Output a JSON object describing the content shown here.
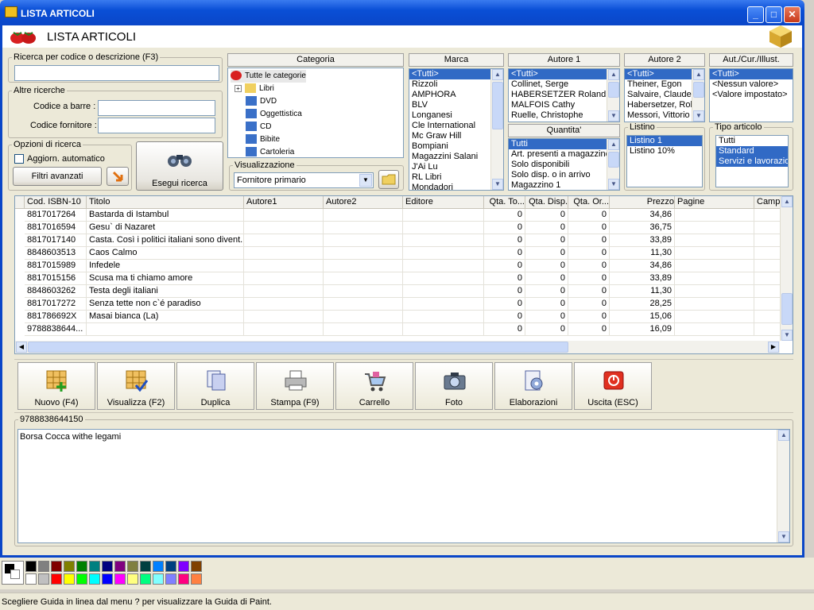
{
  "window": {
    "title": "LISTA ARTICOLI",
    "header": "LISTA ARTICOLI"
  },
  "search": {
    "code_desc_label": "Ricerca per codice o descrizione (F3)",
    "other_label": "Altre ricerche",
    "barcode_label": "Codice a barre :",
    "supplier_code_label": "Codice fornitore :",
    "options_label": "Opzioni di ricerca",
    "auto_update_label": "Aggiorn. automatico",
    "advanced_filters_button": "Filtri avanzati",
    "run_search_button": "Esegui ricerca"
  },
  "categoria": {
    "header": "Categoria",
    "items": [
      "Tutte le categorie",
      "Libri",
      "DVD",
      "Oggettistica",
      "CD",
      "Bibite",
      "Cartoleria"
    ]
  },
  "visualizzazione": {
    "label": "Visualizzazione",
    "value": "Fornitore primario"
  },
  "marca": {
    "header": "Marca",
    "items": [
      "<Tutti>",
      "Rizzoli",
      "AMPHORA",
      "BLV",
      "Longanesi",
      "Cle International",
      "Mc Graw Hill",
      "Bompiani",
      "Magazzini Salani",
      "J'Ai Lu",
      "RL Libri",
      "Mondadori"
    ]
  },
  "autore1": {
    "header": "Autore 1",
    "items": [
      "<Tutti>",
      "Collinet, Serge",
      "HABERSETZER Roland",
      "MALFOIS Cathy",
      "Ruelle, Christophe"
    ]
  },
  "autore2": {
    "header": "Autore 2",
    "items": [
      "<Tutti>",
      "Theiner, Egon",
      "Salvaire, Claude",
      "Habersetzer, Rol",
      "Messori, Vittorio"
    ]
  },
  "autcur": {
    "header": "Aut./Cur./Illust.",
    "items": [
      "<Tutti>",
      "<Nessun valore>",
      "<Valore impostato>"
    ]
  },
  "quantita": {
    "header": "Quantita'",
    "items": [
      "Tutti",
      "Art. presenti a magazzino",
      "Solo disponibili",
      "Solo disp. o in arrivo",
      "Magazzino 1"
    ]
  },
  "listino": {
    "label": "Listino",
    "items": [
      "Listino 1",
      "Listino 10%"
    ]
  },
  "tipo": {
    "label": "Tipo articolo",
    "items": [
      "Tutti",
      "Standard",
      "Servizi e lavorazioni"
    ]
  },
  "grid": {
    "columns": [
      "Cod. ISBN-10",
      "Titolo",
      "Autore1",
      "Autore2",
      "Editore",
      "Qta. To...",
      "Qta. Disp.",
      "Qta. Or...",
      "Prezzo",
      "Pagine",
      "Campo"
    ],
    "rows": [
      [
        "8817017264",
        "Bastarda di Istambul",
        "",
        "",
        "",
        "0",
        "0",
        "0",
        "34,86",
        "",
        ""
      ],
      [
        "8817016594",
        "Gesu` di Nazaret",
        "",
        "",
        "",
        "0",
        "0",
        "0",
        "36,75",
        "",
        ""
      ],
      [
        "8817017140",
        "Casta. Così i politici italiani sono divent...",
        "",
        "",
        "",
        "0",
        "0",
        "0",
        "33,89",
        "",
        ""
      ],
      [
        "8848603513",
        "Caos Calmo",
        "",
        "",
        "",
        "0",
        "0",
        "0",
        "11,30",
        "",
        ""
      ],
      [
        "8817015989",
        "Infedele",
        "",
        "",
        "",
        "0",
        "0",
        "0",
        "34,86",
        "",
        ""
      ],
      [
        "8817015156",
        "Scusa ma ti chiamo amore",
        "",
        "",
        "",
        "0",
        "0",
        "0",
        "33,89",
        "",
        ""
      ],
      [
        "8848603262",
        "Testa degli italiani",
        "",
        "",
        "",
        "0",
        "0",
        "0",
        "11,30",
        "",
        ""
      ],
      [
        "8817017272",
        "Senza tette non c`é paradiso",
        "",
        "",
        "",
        "0",
        "0",
        "0",
        "28,25",
        "",
        ""
      ],
      [
        "881786692X",
        "Masai bianca (La)",
        "",
        "",
        "",
        "0",
        "0",
        "0",
        "15,06",
        "",
        ""
      ],
      [
        "9788838644...",
        "",
        "",
        "",
        "",
        "0",
        "0",
        "0",
        "16,09",
        "",
        ""
      ]
    ]
  },
  "toolbar": [
    {
      "label": "Nuovo (F4)",
      "icon": "new-icon"
    },
    {
      "label": "Visualizza (F2)",
      "icon": "view-icon"
    },
    {
      "label": "Duplica",
      "icon": "duplicate-icon"
    },
    {
      "label": "Stampa (F9)",
      "icon": "printer-icon"
    },
    {
      "label": "Carrello",
      "icon": "cart-icon"
    },
    {
      "label": "Foto",
      "icon": "camera-icon"
    },
    {
      "label": "Elaborazioni",
      "icon": "processing-icon"
    },
    {
      "label": "Uscita (ESC)",
      "icon": "exit-icon"
    }
  ],
  "detail": {
    "code": "9788838644150",
    "text": "Borsa Cocca withe legami"
  },
  "status": {
    "text": "Scegliere Guida in linea dal menu ? per visualizzare la Guida di Paint."
  },
  "palette": [
    "#000000",
    "#808080",
    "#800000",
    "#808000",
    "#008000",
    "#008080",
    "#000080",
    "#800080",
    "#808040",
    "#004040",
    "#0080ff",
    "#004080",
    "#8000ff",
    "#804000",
    "#ffffff",
    "#c0c0c0",
    "#ff0000",
    "#ffff00",
    "#00ff00",
    "#00ffff",
    "#0000ff",
    "#ff00ff",
    "#ffff80",
    "#00ff80",
    "#80ffff",
    "#8080ff",
    "#ff0080",
    "#ff8040"
  ]
}
